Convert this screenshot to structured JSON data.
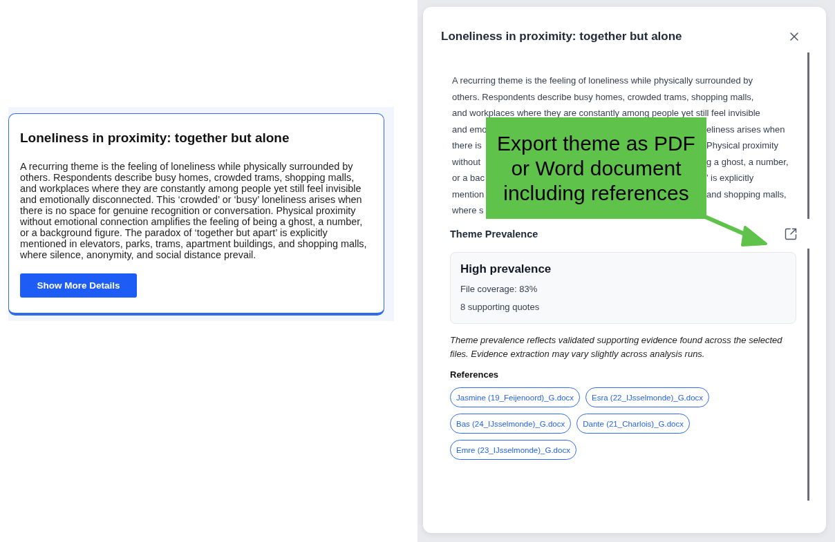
{
  "overview_card": {
    "title": "Loneliness in proximity: together but alone",
    "description": "A recurring theme is the feeling of loneliness while physically surrounded by others. Respondents describe busy homes, crowded trams, shopping malls, and workplaces where they are constantly among people yet still feel invisible and emotionally disconnected. This ‘crowded’ or ‘busy’ loneliness arises when there is no space for genuine recognition or conversation. Physical proximity without emotional connection amplifies the feeling of being a ghost, a number, or a background figure. The paradox of ‘together but apart’ is explicitly mentioned in elevators, parks, trams, apartment buildings, and shopping malls, where silence, anonymity, and social distance prevail.",
    "button": "Show More Details"
  },
  "modal": {
    "title": "Loneliness in proximity: together but alone",
    "description_lines": [
      {
        "text": "A recurring theme is the feeling of loneliness while physically surrounded by"
      },
      {
        "text": "others. Respondents describe busy homes, crowded trams, shopping malls,"
      },
      {
        "text": "and workplaces where they are constantly among people yet still feel invisible"
      },
      {
        "left": "and emo",
        "right": "eliness arises when"
      },
      {
        "left": "there is",
        "right": "Physical proximity"
      },
      {
        "left": "without",
        "right": "g a ghost, a number,"
      },
      {
        "left": "or a bac",
        "right": "’ is explicitly"
      },
      {
        "left": "mention",
        "right": "and shopping malls,"
      },
      {
        "left": "where s"
      }
    ],
    "prevalence": {
      "heading": "Theme Prevalence",
      "level_label": "High prevalence",
      "coverage": "File coverage: 83%",
      "quotes": "8 supporting quotes"
    },
    "note": "Theme prevalence reflects validated supporting evidence found across the selected files. Evidence extraction may vary slightly across analysis runs.",
    "references_heading": "References",
    "references": [
      "Jasmine (19_Feijenoord)_G.docx",
      "Esra (22_IJsselmonde)_G.docx",
      "Bas (24_IJsselmonde)_G.docx",
      "Dante (21_Charlois)_G.docx",
      "Emre (23_IJsselmonde)_G.docx"
    ]
  },
  "callout": {
    "text": "Export theme as PDF or Word document including references"
  }
}
